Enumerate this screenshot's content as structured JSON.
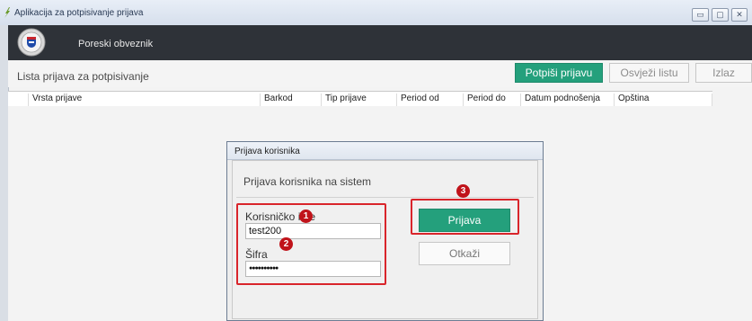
{
  "window": {
    "title": "Aplikacija za potpisivanje prijava",
    "controls": [
      "minimize-icon",
      "maximize-icon",
      "close-icon"
    ]
  },
  "header": {
    "app_name": "Poreski obveznik"
  },
  "toolbar": {
    "list_title": "Lista prijava za potpisivanje",
    "sign_button": "Potpiši prijavu",
    "refresh_button": "Osvježi listu",
    "exit_button": "Izlaz"
  },
  "table": {
    "columns": [
      "Vrsta prijave",
      "Barkod",
      "Tip prijave",
      "Period od",
      "Period do",
      "Datum podnošenja",
      "Opština"
    ]
  },
  "dialog": {
    "title": "Prijava korisnika",
    "subtitle": "Prijava korisnika na sistem",
    "username_label": "Korisničko ime",
    "username_value": "test200",
    "password_label": "Šifra",
    "password_value": "●●●●●●●●●●",
    "login_button": "Prijava",
    "cancel_button": "Otkaži"
  },
  "annotations": [
    "1",
    "2",
    "3"
  ],
  "colors": {
    "accent": "#24a07c",
    "header": "#2e3238",
    "annotation": "#d9252b"
  }
}
